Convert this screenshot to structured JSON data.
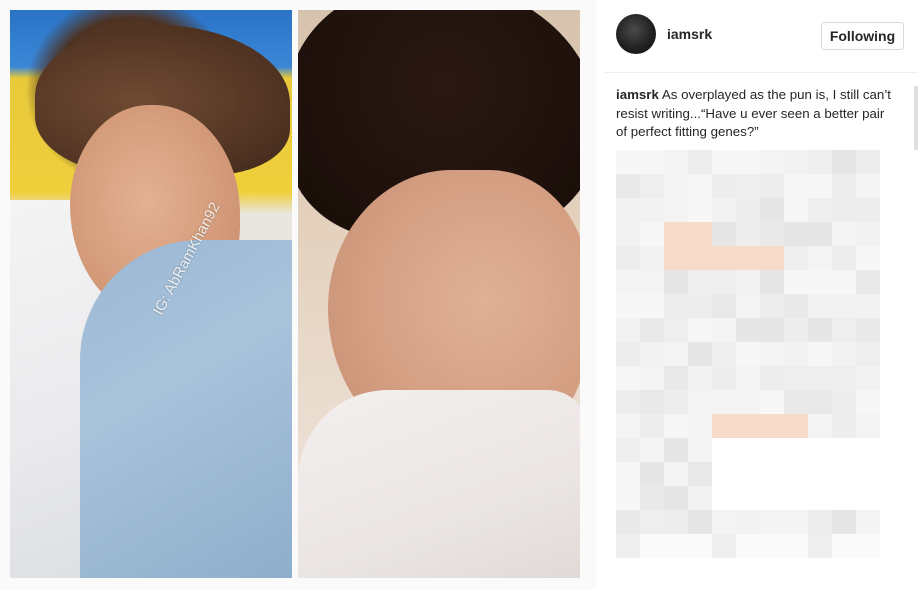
{
  "post": {
    "username": "iamsrk",
    "follow_button": "Following",
    "caption_username": "iamsrk",
    "caption_text": "As overplayed as the pun is, I still can’t resist writing...“Have u ever seen a better pair of perfect fitting genes?”"
  },
  "photo": {
    "watermark": "IG: AbRamKhan92"
  },
  "icons": {
    "avatar": "profile-avatar"
  }
}
